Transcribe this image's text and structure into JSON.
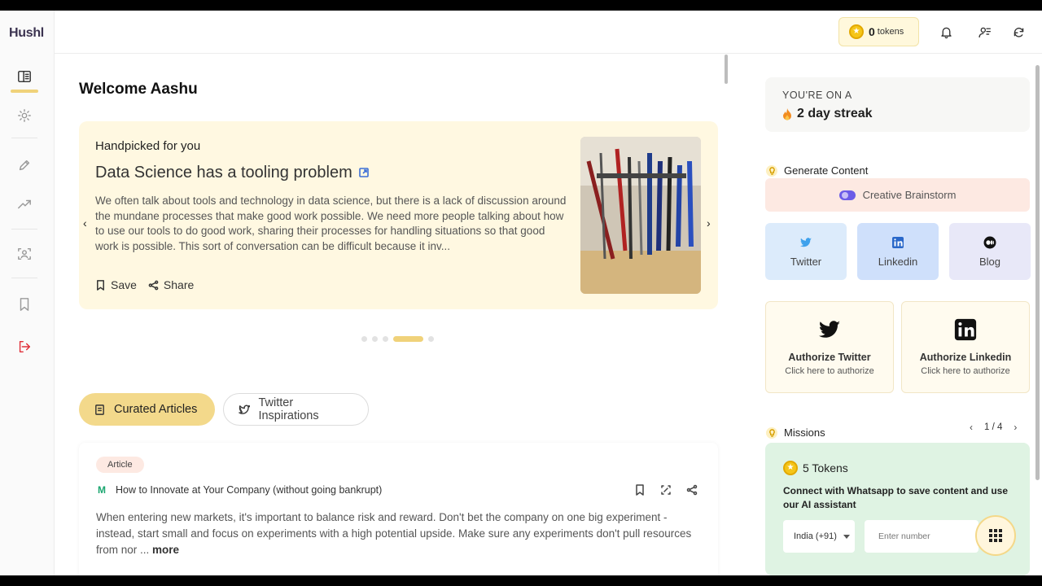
{
  "brand": {
    "logo": "Hushl"
  },
  "topbar": {
    "tokens_count": "0",
    "tokens_label": "tokens"
  },
  "main": {
    "welcome": "Welcome  Aashu",
    "hero": {
      "kicker": "Handpicked for you",
      "title": "Data Science has a tooling problem",
      "text": "We often talk about tools and technology in data science, but there is a lack of discussion around the mundane processes that make good work possible. We need more people talking about how to use our tools to do good work, sharing their processes for handling situations so that good work is possible. This sort of conversation can be difficult because it inv...",
      "save_label": "Save",
      "share_label": "Share",
      "carousel_active_index": 3,
      "carousel_count": 5
    },
    "tabs": [
      {
        "label": "Curated Articles",
        "active": true
      },
      {
        "label": "Twitter Inspirations",
        "active": false
      }
    ],
    "article": {
      "badge": "Article",
      "source_icon": "medium-icon",
      "title": "How to Innovate at Your Company (without going bankrupt)",
      "text": "When entering new markets, it's important to balance risk and reward. Don't bet the company on one big experiment - instead, start small and focus on experiments with a high potential upside. Make sure any experiments don't pull resources from nor ...",
      "more_label": "more"
    }
  },
  "right": {
    "streak_label": "YOU'RE ON A",
    "streak_value": "2 day streak",
    "generate_heading": "Generate Content",
    "brainstorm_label": "Creative Brainstorm",
    "gen_cards": [
      {
        "label": "Twitter",
        "icon": "twitter-icon",
        "color": "#dcebfb"
      },
      {
        "label": "Linkedin",
        "icon": "linkedin-icon",
        "color": "#cfe0fb"
      },
      {
        "label": "Blog",
        "icon": "medium-icon",
        "color": "#e8e8f8"
      }
    ],
    "auth_cards": [
      {
        "title": "Authorize Twitter",
        "sub": "Click here to authorize"
      },
      {
        "title": "Authorize Linkedin",
        "sub": "Click here to authorize"
      }
    ],
    "missions_heading": "Missions",
    "missions_page": "1 / 4",
    "mission": {
      "tokens": "5 Tokens",
      "text": "Connect with Whatsapp to save content and use our AI assistant",
      "country": "India (+91)",
      "phone_placeholder": "Enter number"
    }
  },
  "colors": {
    "accent": "#f3d98b",
    "hero_bg": "#fff8e1",
    "mission_bg": "#dff3e3",
    "logout": "#e0303a"
  }
}
